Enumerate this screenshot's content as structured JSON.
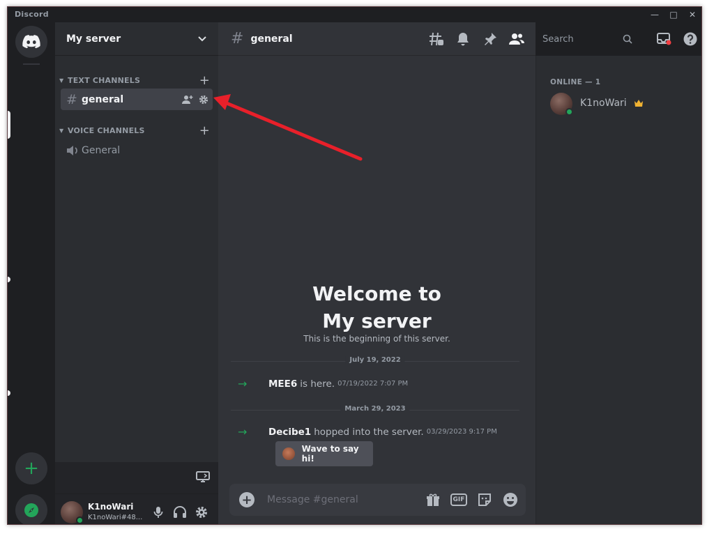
{
  "window": {
    "app_title": "Discord"
  },
  "server": {
    "name": "My server"
  },
  "sidebar": {
    "text_category": "TEXT CHANNELS",
    "voice_category": "VOICE CHANNELS",
    "text_channels": [
      {
        "name": "general"
      }
    ],
    "voice_channels": [
      {
        "name": "General"
      }
    ]
  },
  "user": {
    "name": "K1noWari",
    "tag": "K1noWari#48..."
  },
  "chat": {
    "channel": "general",
    "search_placeholder": "Search",
    "welcome_line1": "Welcome to",
    "welcome_line2": "My server",
    "welcome_sub": "This is the beginning of this server.",
    "messages": [
      {
        "date": "July 19, 2022",
        "author": "MEE6",
        "text": "is here.",
        "time": "07/19/2022 7:07 PM"
      },
      {
        "date": "March 29, 2023",
        "author": "Decibe1",
        "text": "hopped into the server.",
        "time": "03/29/2023 9:17 PM"
      }
    ],
    "wave_label": "Wave to say hi!",
    "composer_placeholder": "Message #general",
    "gif_label": "GIF"
  },
  "members": {
    "online_header": "ONLINE — 1",
    "list": [
      {
        "name": "K1noWari",
        "role": "owner"
      }
    ]
  },
  "icons": {
    "home": "discord-logo-icon",
    "add_server": "plus-icon",
    "explore": "compass-icon",
    "threads": "threads-icon",
    "bell": "bell-icon",
    "pin": "pin-icon",
    "members": "members-icon",
    "inbox": "inbox-icon",
    "help": "help-icon",
    "mic": "microphone-icon",
    "headset": "headphones-icon",
    "settings": "gear-icon"
  },
  "colors": {
    "accent_green": "#23a55a",
    "annotation_red": "#e8202a",
    "background": "#313338"
  }
}
